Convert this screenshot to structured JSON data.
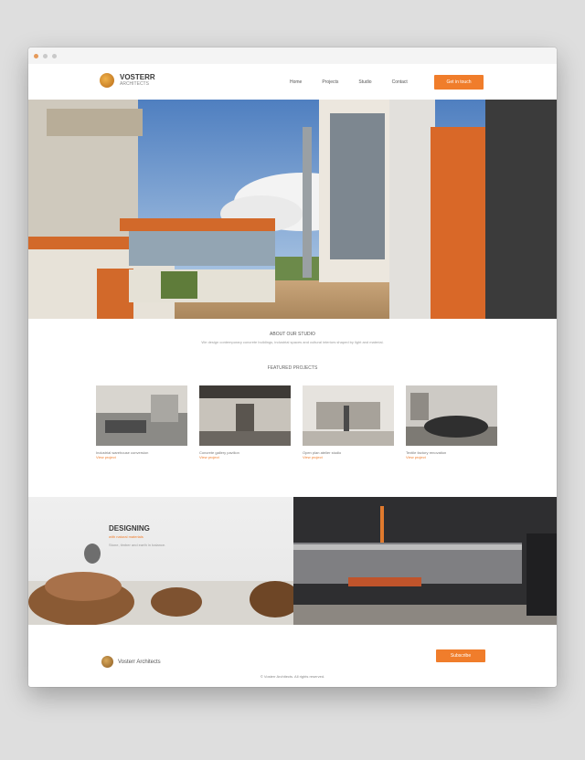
{
  "site": {
    "logo_text": "VOSTERR",
    "logo_sub": "ARCHITECTS"
  },
  "nav": {
    "items": [
      "Home",
      "Projects",
      "Studio",
      "Contact"
    ],
    "cta": "Get in touch"
  },
  "intro": {
    "title": "ABOUT OUR STUDIO",
    "line": "We design contemporary concrete buildings, industrial spaces and cultural interiors shaped by light and material."
  },
  "projects": {
    "title": "FEATURED PROJECTS",
    "items": [
      {
        "caption": "Industrial warehouse conversion",
        "link": "View project"
      },
      {
        "caption": "Concrete gallery pavilion",
        "link": "View project"
      },
      {
        "caption": "Open plan atelier studio",
        "link": "View project"
      },
      {
        "caption": "Textile factory renovation",
        "link": "View project"
      }
    ]
  },
  "feature": {
    "title": "DESIGNING",
    "subtitle": "with natural materials",
    "line": "Stone, timber and earth in balance."
  },
  "footer": {
    "logo_text": "Vosterr Architects",
    "cta": "Subscribe",
    "copyright": "© Vosterr Architects. All rights reserved."
  },
  "colors": {
    "accent": "#f07d2b",
    "dark": "#3a3a3a"
  }
}
